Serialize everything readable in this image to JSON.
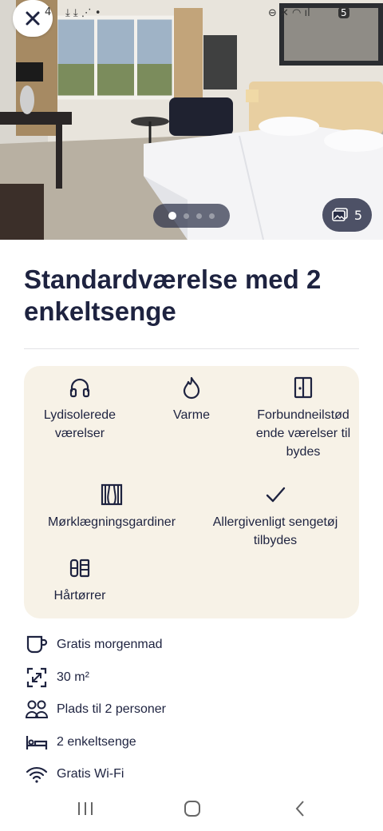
{
  "status_bar": {
    "time_fragment": "4",
    "battery": "5"
  },
  "gallery": {
    "photo_count": "5",
    "slides_total": 4,
    "active_slide": 1
  },
  "room": {
    "title": "Standardværelse med 2 enkeltsenge"
  },
  "amenities": [
    {
      "icon": "headphones-icon",
      "label": "Lydisolerede værelser"
    },
    {
      "icon": "flame-icon",
      "label": "Varme"
    },
    {
      "icon": "connecting-door-icon",
      "label": "Forbundneilstødende værelser tilbydes"
    },
    {
      "icon": "curtains-icon",
      "label": "Mørklægningsgardiner"
    },
    {
      "icon": "check-icon",
      "label": "Allergivenligt sengetøj tilbydes"
    },
    {
      "icon": "hair-dryer-icon",
      "label": "Hårtørrer"
    }
  ],
  "features": [
    {
      "icon": "coffee-cup-icon",
      "label": "Gratis morgenmad"
    },
    {
      "icon": "room-size-icon",
      "label": "30 m²"
    },
    {
      "icon": "people-icon",
      "label": "Plads til 2 personer"
    },
    {
      "icon": "bed-icon",
      "label": "2 enkeltsenge"
    },
    {
      "icon": "wifi-icon",
      "label": "Gratis Wi-Fi"
    }
  ],
  "colors": {
    "text": "#1e2340",
    "panel": "#f7f2e7",
    "divider": "#e2e2e6"
  }
}
